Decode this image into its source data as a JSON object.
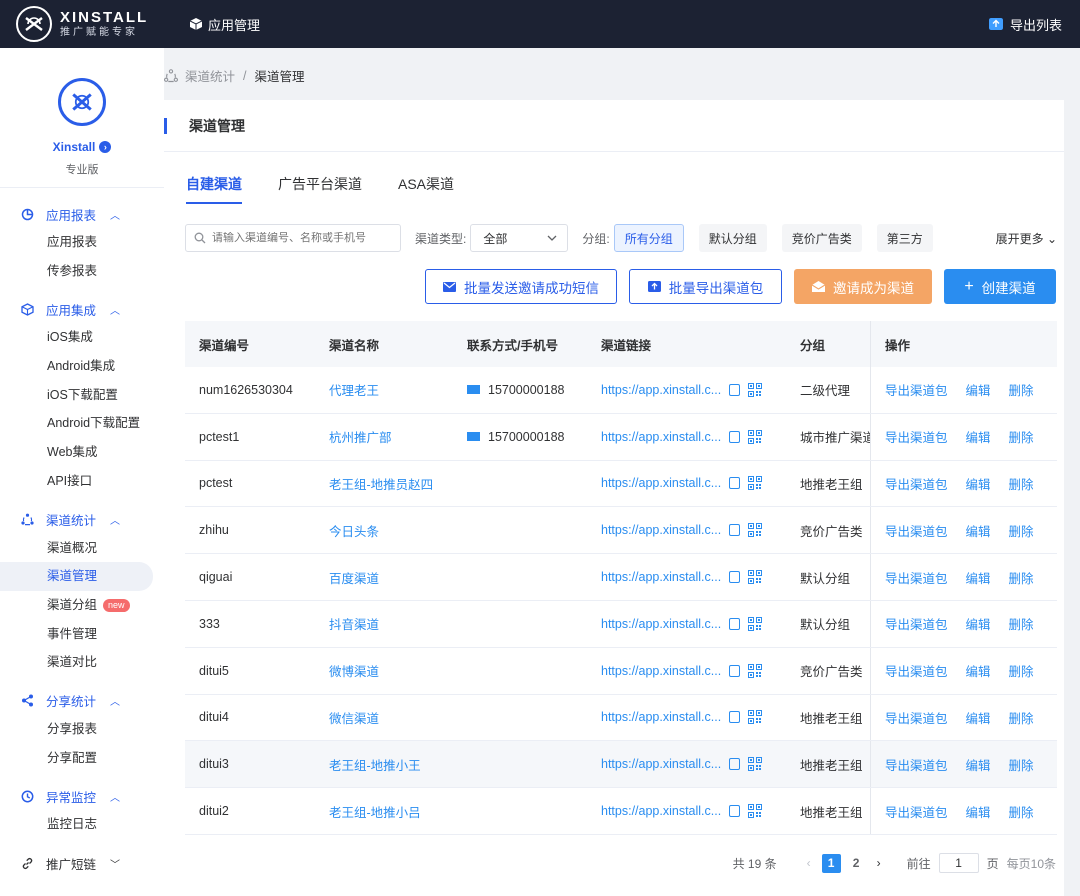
{
  "topbar": {
    "brand": "XINSTALL",
    "slogan": "推广赋能专家",
    "nav_item": "应用管理",
    "export_label": "导出列表"
  },
  "profile": {
    "name": "Xinstall",
    "edition": "专业版"
  },
  "sidebar": {
    "groups": [
      {
        "title": "应用报表",
        "items": [
          "应用报表",
          "传参报表"
        ]
      },
      {
        "title": "应用集成",
        "items": [
          "iOS集成",
          "Android集成",
          "iOS下载配置",
          "Android下载配置",
          "Web集成",
          "API接口"
        ]
      },
      {
        "title": "渠道统计",
        "items": [
          "渠道概况",
          "渠道管理",
          "渠道分组",
          "事件管理",
          "渠道对比"
        ]
      },
      {
        "title": "分享统计",
        "items": [
          "分享报表",
          "分享配置"
        ]
      },
      {
        "title": "异常监控",
        "items": [
          "监控日志"
        ]
      },
      {
        "title": "推广短链",
        "items": []
      }
    ],
    "new_badge": "new"
  },
  "breadcrumb": {
    "parent": "渠道统计",
    "separator": "/",
    "current": "渠道管理"
  },
  "page": {
    "title": "渠道管理"
  },
  "tabs": [
    "自建渠道",
    "广告平台渠道",
    "ASA渠道"
  ],
  "filters": {
    "search_placeholder": "请输入渠道编号、名称或手机号",
    "type_label": "渠道类型:",
    "type_value": "全部",
    "group_label": "分组:",
    "groups": [
      "所有分组",
      "默认分组",
      "竞价广告类",
      "第三方"
    ],
    "expand_label": "展开更多"
  },
  "actions": {
    "sms": "批量发送邀请成功短信",
    "export": "批量导出渠道包",
    "invite": "邀请成为渠道",
    "create": "创建渠道"
  },
  "table": {
    "headers": [
      "渠道编号",
      "渠道名称",
      "联系方式/手机号",
      "渠道链接",
      "分组",
      "操作"
    ],
    "ops": [
      "导出渠道包",
      "编辑",
      "删除"
    ],
    "rows": [
      {
        "id": "num1626530304",
        "name": "代理老王",
        "phone": "15700000188",
        "link": "https://app.xinstall.c...",
        "group": "二级代理"
      },
      {
        "id": "pctest1",
        "name": "杭州推广部",
        "phone": "15700000188",
        "link": "https://app.xinstall.c...",
        "group": "城市推广渠道"
      },
      {
        "id": "pctest",
        "name": "老王组-地推员赵四",
        "phone": "",
        "link": "https://app.xinstall.c...",
        "group": "地推老王组"
      },
      {
        "id": "zhihu",
        "name": "今日头条",
        "phone": "",
        "link": "https://app.xinstall.c...",
        "group": "竞价广告类"
      },
      {
        "id": "qiguai",
        "name": "百度渠道",
        "phone": "",
        "link": "https://app.xinstall.c...",
        "group": "默认分组"
      },
      {
        "id": "333",
        "name": "抖音渠道",
        "phone": "",
        "link": "https://app.xinstall.c...",
        "group": "默认分组"
      },
      {
        "id": "ditui5",
        "name": "微博渠道",
        "phone": "",
        "link": "https://app.xinstall.c...",
        "group": "竞价广告类"
      },
      {
        "id": "ditui4",
        "name": "微信渠道",
        "phone": "",
        "link": "https://app.xinstall.c...",
        "group": "地推老王组"
      },
      {
        "id": "ditui3",
        "name": "老王组-地推小王",
        "phone": "",
        "link": "https://app.xinstall.c...",
        "group": "地推老王组"
      },
      {
        "id": "ditui2",
        "name": "老王组-地推小吕",
        "phone": "",
        "link": "https://app.xinstall.c...",
        "group": "地推老王组"
      }
    ]
  },
  "pagination": {
    "total": "共 19 条",
    "pages": [
      "1",
      "2"
    ],
    "goto_label": "前往",
    "goto_value": "1",
    "unit": "页",
    "page_size": "每页10条"
  },
  "colors": {
    "primary": "#2a5de8",
    "link": "#2a8df0",
    "orange": "#f4a565",
    "topbar": "#1c2233"
  }
}
